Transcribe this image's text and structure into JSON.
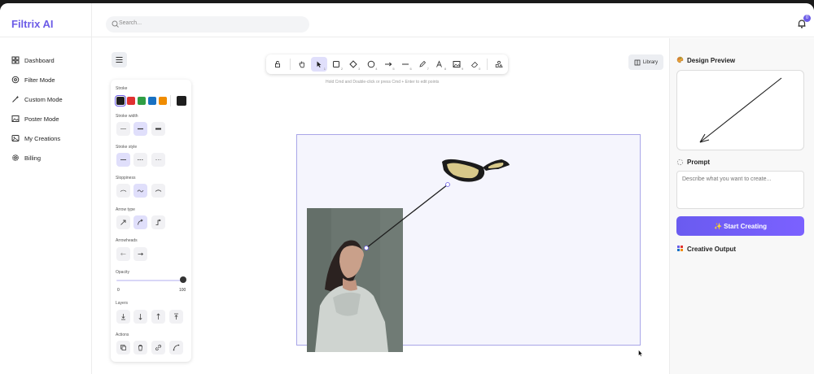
{
  "app": {
    "title": "Filtrix AI",
    "accent": "#6c5ce7"
  },
  "search": {
    "placeholder": "Search..."
  },
  "notifications": {
    "count": "0"
  },
  "sidebar": {
    "items": [
      {
        "label": "Dashboard",
        "icon": "grid-icon"
      },
      {
        "label": "Filter Mode",
        "icon": "filter-icon"
      },
      {
        "label": "Custom Mode",
        "icon": "wand-icon"
      },
      {
        "label": "Poster Mode",
        "icon": "image-icon"
      },
      {
        "label": "My Creations",
        "icon": "gallery-icon"
      },
      {
        "label": "Billing",
        "icon": "gear-icon"
      }
    ]
  },
  "toolbar": {
    "tools": [
      {
        "name": "lock",
        "key": ""
      },
      {
        "name": "hand",
        "key": ""
      },
      {
        "name": "select",
        "key": "1"
      },
      {
        "name": "rectangle",
        "key": "2"
      },
      {
        "name": "diamond",
        "key": "3"
      },
      {
        "name": "ellipse",
        "key": "4"
      },
      {
        "name": "arrow",
        "key": "5"
      },
      {
        "name": "line",
        "key": "6"
      },
      {
        "name": "draw",
        "key": "7"
      },
      {
        "name": "text",
        "key": "8"
      },
      {
        "name": "image",
        "key": "9"
      },
      {
        "name": "eraser",
        "key": "0"
      },
      {
        "name": "more",
        "key": ""
      }
    ],
    "hint": "Hold Cmd and Double-click or press Cmd + Enter to edit points",
    "library_label": "Library"
  },
  "properties": {
    "stroke_label": "Stroke",
    "stroke_colors": [
      "#1e1e1e",
      "#e03131",
      "#2f9e44",
      "#1971c2",
      "#f08c00"
    ],
    "stroke_current": "#1e1e1e",
    "stroke_width_label": "Stroke width",
    "stroke_style_label": "Stroke style",
    "sloppiness_label": "Sloppiness",
    "arrow_type_label": "Arrow type",
    "arrowheads_label": "Arrowheads",
    "opacity_label": "Opacity",
    "opacity_min": "0",
    "opacity_max": "100",
    "opacity_value": 100,
    "layers_label": "Layers",
    "actions_label": "Actions"
  },
  "right_panel": {
    "design_preview_title": "Design Preview",
    "prompt_title": "Prompt",
    "prompt_placeholder": "Describe what you want to create...",
    "start_button": "✨ Start Creating",
    "output_title": "Creative Output"
  }
}
